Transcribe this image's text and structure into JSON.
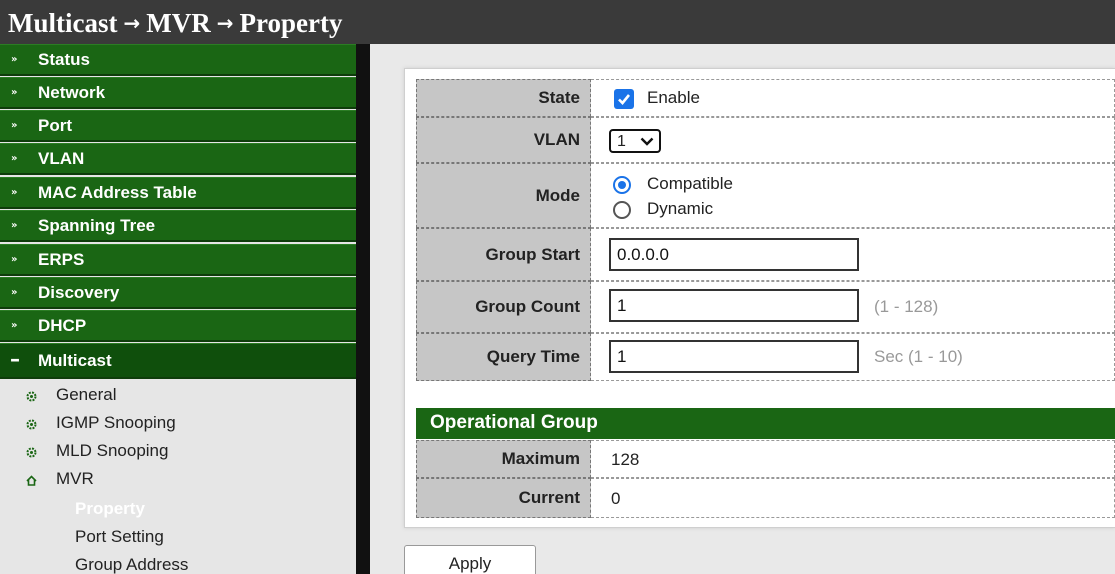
{
  "header": {
    "crumb1": "Multicast",
    "crumb2": "MVR",
    "crumb3": "Property",
    "arrow": "→"
  },
  "sidebar": {
    "menu": [
      "Status",
      "Network",
      "Port",
      "VLAN",
      "MAC Address Table",
      "Spanning Tree",
      "ERPS",
      "Discovery",
      "DHCP"
    ],
    "active_menu": "Multicast",
    "sub_items": [
      "General",
      "IGMP Snooping",
      "MLD Snooping",
      "MVR"
    ],
    "mvr_children": [
      "Property",
      "Port Setting",
      "Group Address"
    ]
  },
  "form": {
    "state_label": "State",
    "state_option": "Enable",
    "state_checked": true,
    "vlan_label": "VLAN",
    "vlan_value": "1",
    "mode_label": "Mode",
    "mode_options": [
      "Compatible",
      "Dynamic"
    ],
    "mode_selected": "Compatible",
    "group_start_label": "Group Start",
    "group_start_value": "0.0.0.0",
    "group_count_label": "Group Count",
    "group_count_value": "1",
    "group_count_range": "(1 - 128)",
    "query_time_label": "Query Time",
    "query_time_value": "1",
    "query_time_range": "Sec (1 - 10)"
  },
  "operational": {
    "title": "Operational Group",
    "maximum_label": "Maximum",
    "maximum_value": "128",
    "current_label": "Current",
    "current_value": "0"
  },
  "buttons": {
    "apply": "Apply"
  },
  "colors": {
    "menu_green": "#1a6614",
    "active_green": "#0f4f0c",
    "accent_blue": "#1a73e8",
    "header_bg": "#3a3a3a"
  }
}
